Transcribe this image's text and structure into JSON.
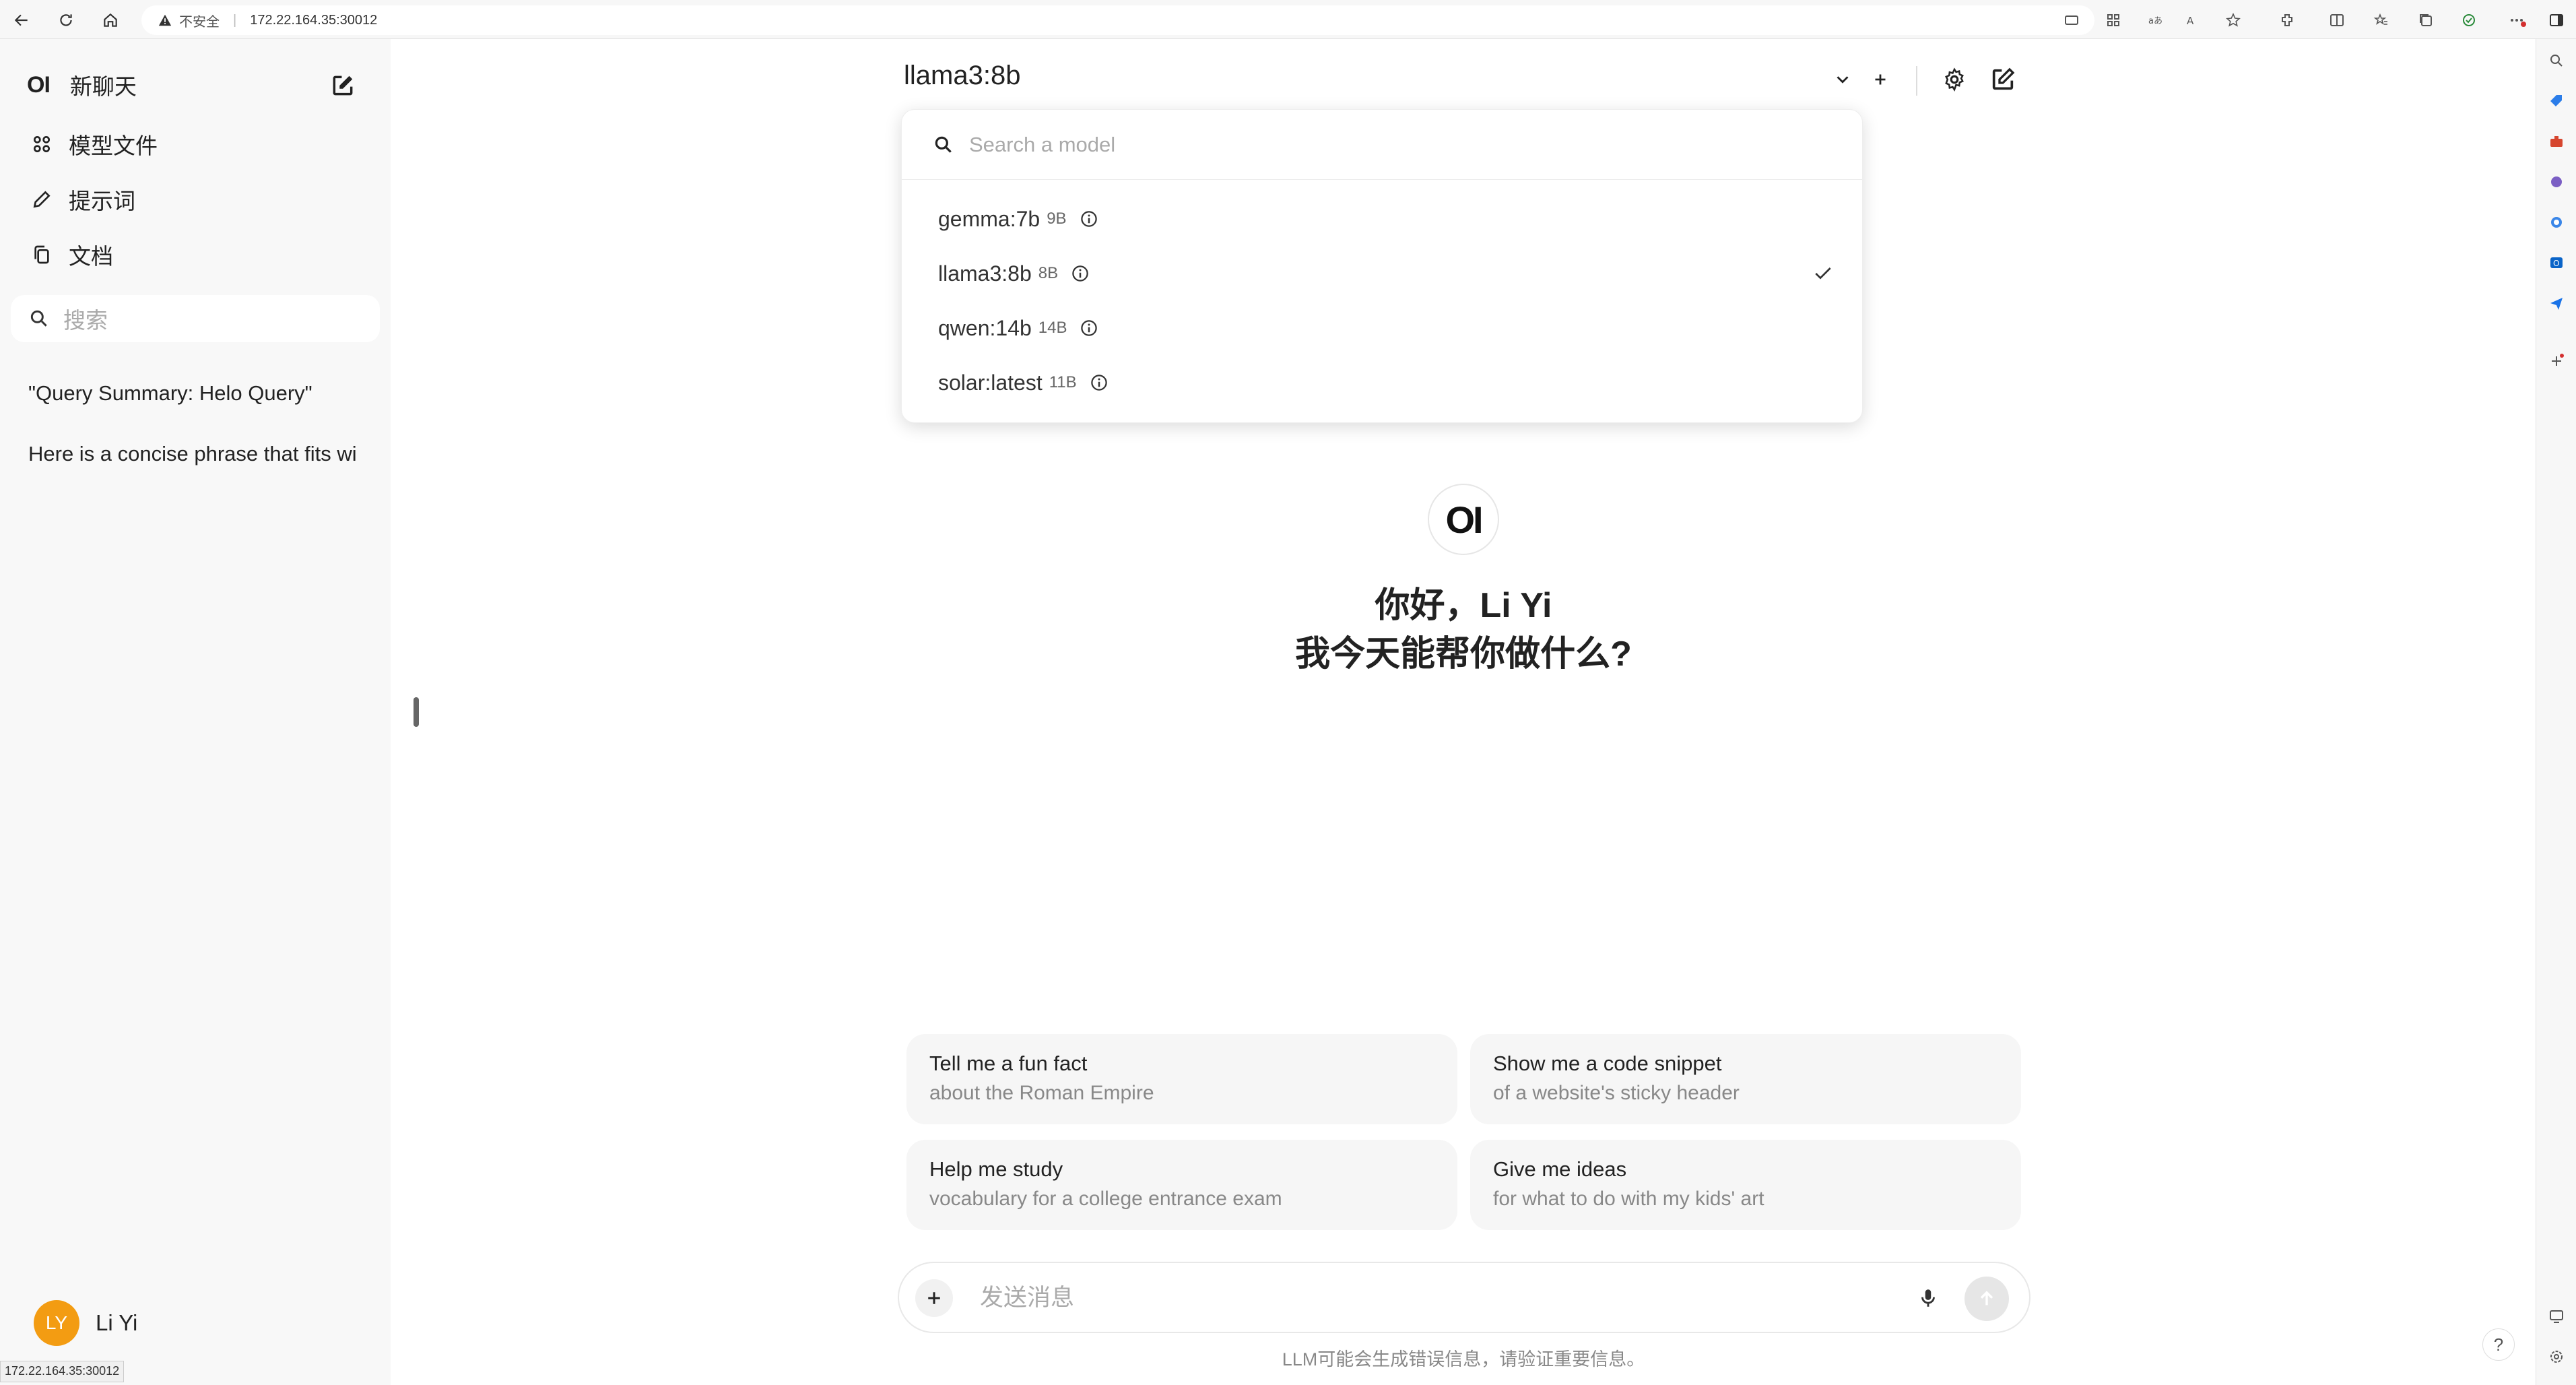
{
  "browser": {
    "insecure_label": "不安全",
    "url": "172.22.164.35:30012",
    "status_url": "172.22.164.35:30012"
  },
  "sidebar": {
    "logo": "OI",
    "new_chat": "新聊天",
    "items": [
      {
        "label": "模型文件",
        "icon": "grid-icon"
      },
      {
        "label": "提示词",
        "icon": "pencil-icon"
      },
      {
        "label": "文档",
        "icon": "documents-icon"
      }
    ],
    "search_placeholder": "搜索",
    "chats": [
      "\"Query Summary: Helo Query\"",
      "Here is a concise phrase that fits wi"
    ],
    "user": {
      "initials": "LY",
      "name": "Li Yi",
      "avatar_color": "#f39c12"
    }
  },
  "header": {
    "model": "llama3:8b"
  },
  "model_menu": {
    "search_placeholder": "Search a model",
    "options": [
      {
        "name": "gemma:7b",
        "size": "9B",
        "selected": false
      },
      {
        "name": "llama3:8b",
        "size": "8B",
        "selected": true
      },
      {
        "name": "qwen:14b",
        "size": "14B",
        "selected": false
      },
      {
        "name": "solar:latest",
        "size": "11B",
        "selected": false
      }
    ]
  },
  "welcome": {
    "logo": "OI",
    "line1": "你好，Li Yi",
    "line2": "我今天能帮你做什么?"
  },
  "suggestions": [
    {
      "title": "Tell me a fun fact",
      "subtitle": "about the Roman Empire"
    },
    {
      "title": "Show me a code snippet",
      "subtitle": "of a website's sticky header"
    },
    {
      "title": "Help me study",
      "subtitle": "vocabulary for a college entrance exam"
    },
    {
      "title": "Give me ideas",
      "subtitle": "for what to do with my kids' art"
    }
  ],
  "composer": {
    "placeholder": "发送消息",
    "disclaimer": "LLM可能会生成错误信息，请验证重要信息。"
  },
  "help": "?"
}
